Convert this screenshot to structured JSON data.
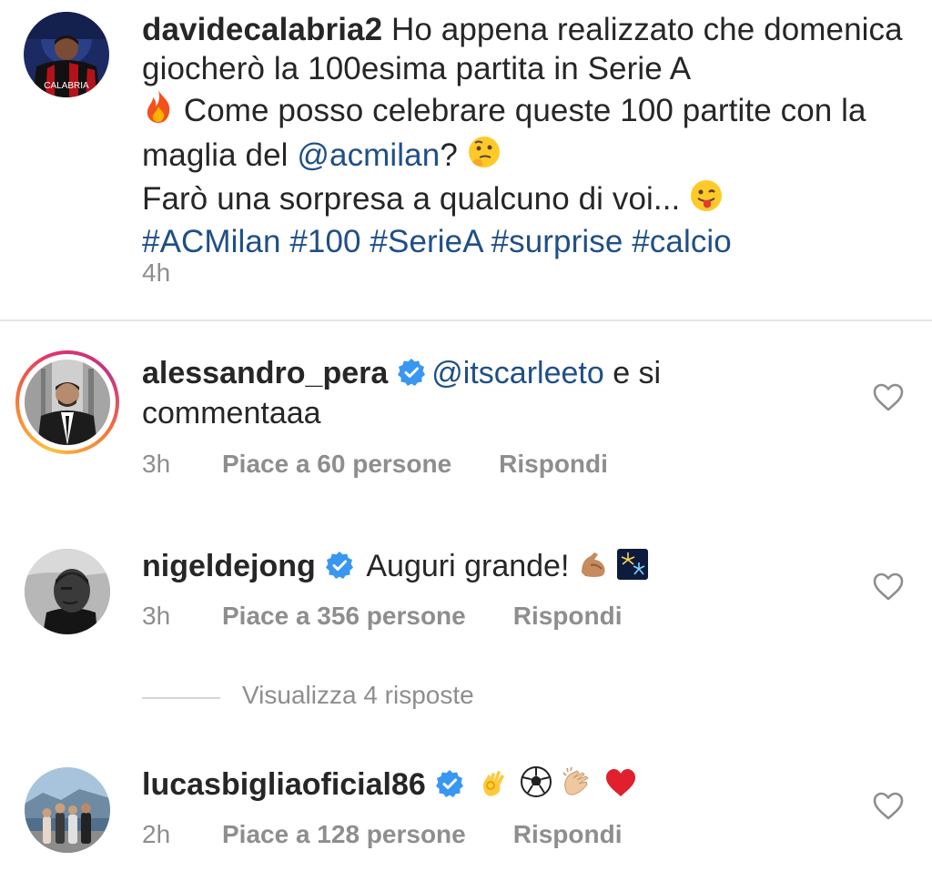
{
  "post": {
    "username": "davidecalabria2",
    "caption_line1": "Ho appena realizzato che domenica giocherò la 100esima partita in Serie A",
    "caption_line2": "Come posso celebrare queste 100 partite con la maglia del",
    "mention": "@acmilan",
    "caption_line3": "?",
    "caption_line4": "Farò una sorpresa a qualcuno di voi...",
    "hashtags": "#ACMilan #100 #SerieA #surprise #calcio",
    "time": "4h",
    "avatar_jersey_text": "CALABRIA"
  },
  "comments": [
    {
      "username": "alessandro_pera",
      "mention": "@itscarleeto",
      "text": "e si commentaaa",
      "time": "3h",
      "likes": "Piace a 60 persone",
      "reply": "Rispondi"
    },
    {
      "username": "nigeldejong",
      "text": "Auguri grande!",
      "time": "3h",
      "likes": "Piace a 356 persone",
      "reply": "Rispondi",
      "view_replies": "Visualizza 4 risposte"
    },
    {
      "username": "lucasbigliaoficial86",
      "text": "",
      "time": "2h",
      "likes": "Piace a 128 persone",
      "reply": "Rispondi"
    }
  ],
  "colors": {
    "text": "#262626",
    "muted": "#8e8e8e",
    "link": "#1f4f86",
    "verified": "#3897f0",
    "divider": "#e6e6e6"
  }
}
